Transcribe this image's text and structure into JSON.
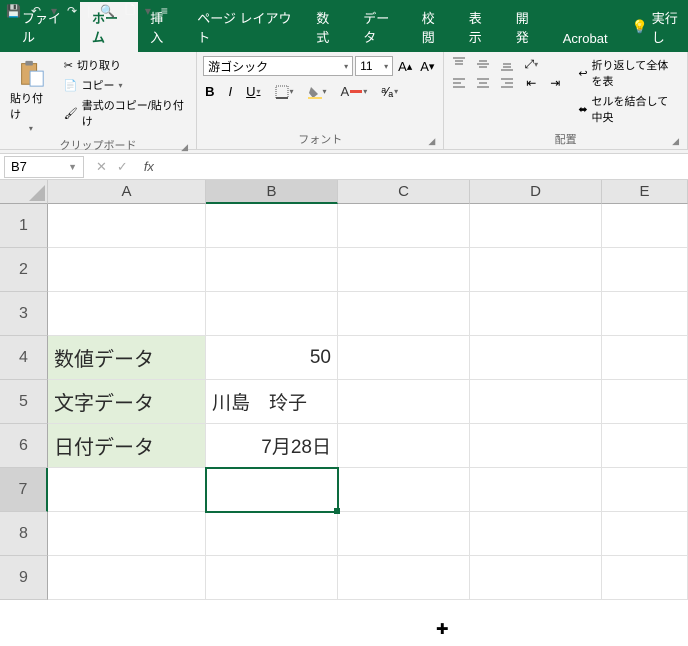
{
  "qat": {
    "save": "💾",
    "undo": "↶",
    "redo": "↷",
    "preview": "🔍",
    "new": "🗋",
    "more": "≡"
  },
  "tabs": [
    "ファイル",
    "ホーム",
    "挿入",
    "ページ レイアウト",
    "数式",
    "データ",
    "校閲",
    "表示",
    "開発",
    "Acrobat"
  ],
  "active_tab": 1,
  "tell": {
    "icon": "💡",
    "label": "実行し"
  },
  "ribbon": {
    "clipboard": {
      "paste": "貼り付け",
      "cut": "切り取り",
      "copy": "コピー",
      "format": "書式のコピー/貼り付け",
      "label": "クリップボード"
    },
    "font": {
      "name": "游ゴシック",
      "size": "11",
      "bold": "B",
      "italic": "I",
      "underline": "U",
      "ruby": "ᵃ⁄ₐ",
      "label": "フォント"
    },
    "align": {
      "wrap": "折り返して全体を表",
      "merge": "セルを結合して中央",
      "label": "配置"
    }
  },
  "namebox": "B7",
  "formula": "",
  "columns": [
    "A",
    "B",
    "C",
    "D",
    "E"
  ],
  "rows": [
    "1",
    "2",
    "3",
    "4",
    "5",
    "6",
    "7",
    "8",
    "9"
  ],
  "selected_col": 1,
  "selected_row": 6,
  "cells": {
    "A4": "数値データ",
    "B4": "50",
    "A5": "文字データ",
    "B5": "川島　玲子",
    "A6": "日付データ",
    "B6": "7月28日"
  }
}
